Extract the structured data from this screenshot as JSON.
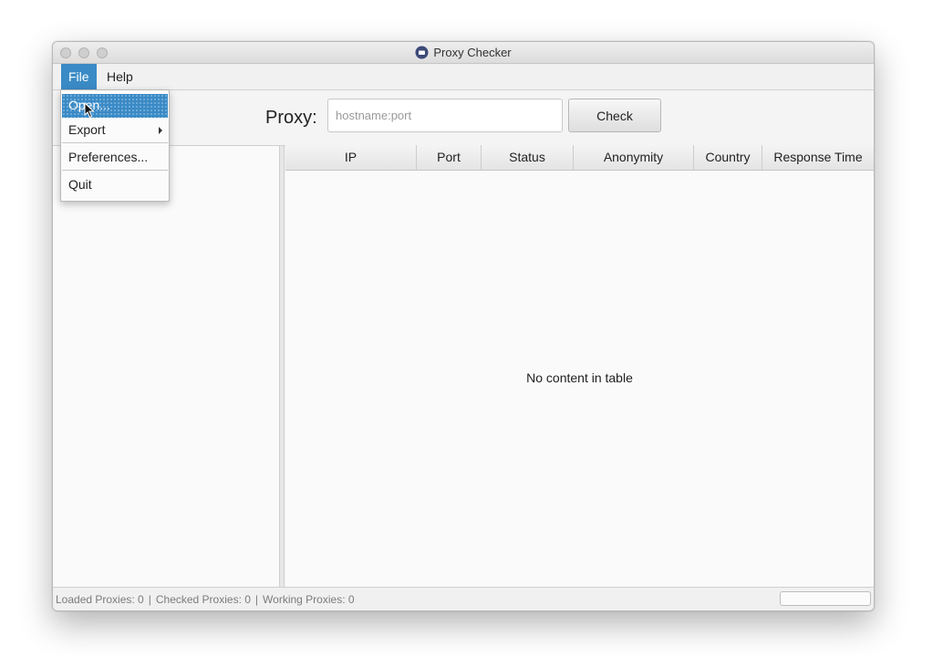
{
  "window": {
    "title": "Proxy Checker"
  },
  "menubar": {
    "file": "File",
    "help": "Help"
  },
  "file_menu": {
    "items": [
      {
        "label": "Open...",
        "highlighted": true
      },
      {
        "label": "Export",
        "has_submenu": true
      },
      {
        "label": "Preferences..."
      },
      {
        "label": "Quit"
      }
    ]
  },
  "toolbar": {
    "proxy_label": "Proxy:",
    "proxy_input_value": "",
    "proxy_input_placeholder": "hostname:port",
    "check_label": "Check"
  },
  "table": {
    "columns": [
      "IP",
      "Port",
      "Status",
      "Anonymity",
      "Country",
      "Response Time"
    ],
    "rows": [],
    "empty_message": "No content in table"
  },
  "statusbar": {
    "loaded": "Loaded Proxies: 0",
    "checked": "Checked Proxies: 0",
    "working": "Working Proxies: 0",
    "separator": "|",
    "progress": 0
  },
  "colors": {
    "accent": "#3a8ac6",
    "window_bg": "#f3f3f3",
    "pane_bg": "#fafafa"
  },
  "icons": [
    "app-icon",
    "submenu-arrow-icon",
    "mouse-cursor-icon"
  ]
}
